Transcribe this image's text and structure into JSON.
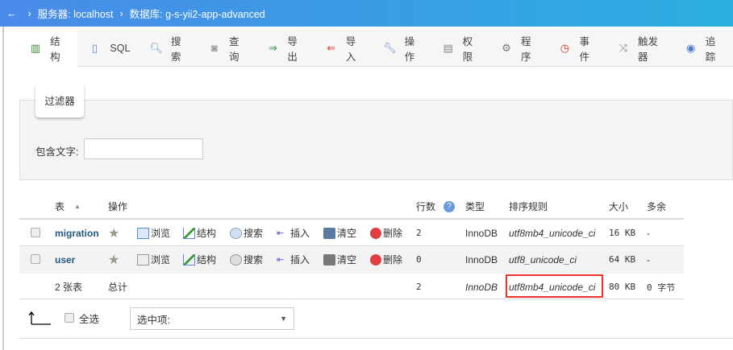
{
  "breadcrumb": {
    "back": "←",
    "server": "服务器: localhost",
    "database": "数据库: g-s-yii2-app-advanced"
  },
  "tabs": [
    {
      "label": "结构",
      "icon": "structure-icon"
    },
    {
      "label": "SQL",
      "icon": "sql-icon"
    },
    {
      "label": "搜索",
      "icon": "search-icon"
    },
    {
      "label": "查询",
      "icon": "query-icon"
    },
    {
      "label": "导出",
      "icon": "export-icon"
    },
    {
      "label": "导入",
      "icon": "import-icon"
    },
    {
      "label": "操作",
      "icon": "wrench-icon"
    },
    {
      "label": "权限",
      "icon": "privileges-icon"
    },
    {
      "label": "程序",
      "icon": "routines-icon"
    },
    {
      "label": "事件",
      "icon": "events-icon"
    },
    {
      "label": "触发器",
      "icon": "triggers-icon"
    },
    {
      "label": "追踪",
      "icon": "eye-icon"
    }
  ],
  "filter": {
    "legend": "过滤器",
    "label": "包含文字:",
    "value": ""
  },
  "table": {
    "headers": {
      "table": "表",
      "sort": "▲",
      "actions": "操作",
      "rows": "行数",
      "type": "类型",
      "collation": "排序规则",
      "size": "大小",
      "overhead": "多余"
    },
    "action_labels": {
      "browse": "浏览",
      "structure": "结构",
      "search": "搜索",
      "insert": "插入",
      "empty": "清空",
      "drop": "删除"
    },
    "rows": [
      {
        "name": "migration",
        "rows": "2",
        "type": "InnoDB",
        "collation": "utf8mb4_unicode_ci",
        "size": "16 KB",
        "overhead": "-"
      },
      {
        "name": "user",
        "rows": "0",
        "type": "InnoDB",
        "collation": "utf8_unicode_ci",
        "size": "64 KB",
        "overhead": "-"
      }
    ],
    "total": {
      "count": "2 张表",
      "label": "总计",
      "rows": "2",
      "type": "InnoDB",
      "collation": "utf8mb4_unicode_ci",
      "size": "80 KB",
      "overhead": "0 字节"
    }
  },
  "footer": {
    "select_all": "全选",
    "with_selected": "选中项:"
  }
}
